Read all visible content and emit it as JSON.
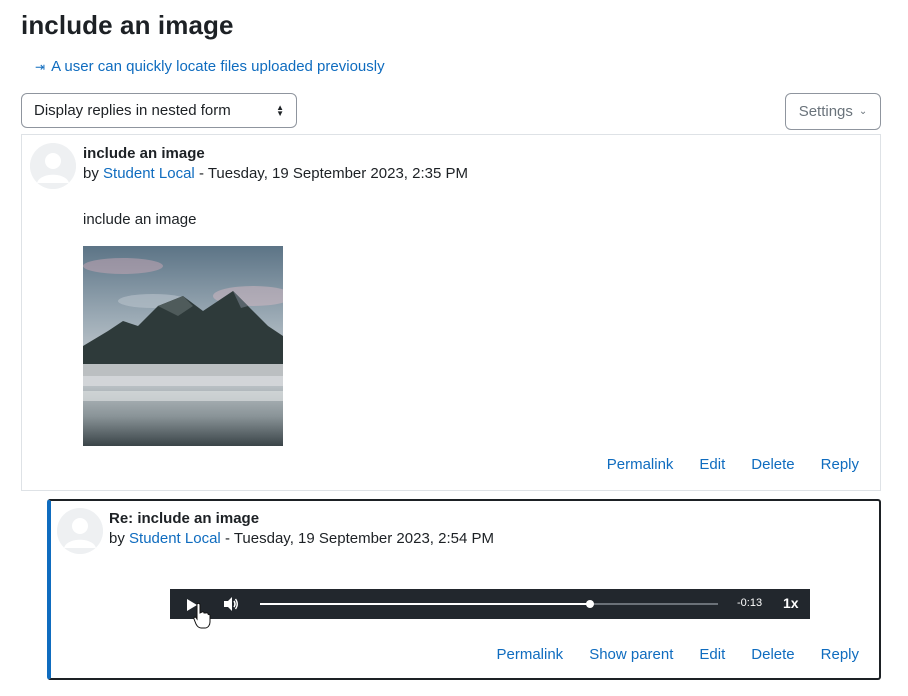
{
  "page": {
    "title": "include an image",
    "nav_link": "A user can quickly locate files uploaded previously",
    "display_mode": "Display replies in nested form",
    "settings_label": "Settings"
  },
  "posts": [
    {
      "subject": "include an image",
      "by_prefix": "by",
      "author": "Student Local",
      "date": "- Tuesday, 19 September 2023, 2:35 PM",
      "body_text": "include an image",
      "image": "mountain-landscape-image",
      "actions": [
        "Permalink",
        "Edit",
        "Delete",
        "Reply"
      ]
    },
    {
      "subject": "Re: include an image",
      "by_prefix": "by",
      "author": "Student Local",
      "date": "- Tuesday, 19 September 2023, 2:54 PM",
      "media": {
        "time_remaining": "-0:13",
        "speed": "1x",
        "progress_fraction": 0.72
      },
      "actions": [
        "Permalink",
        "Show parent",
        "Edit",
        "Delete",
        "Reply"
      ]
    }
  ],
  "colors": {
    "link": "#0f6cbf",
    "text": "#1d2125",
    "player_bg": "#22272d",
    "border": "#dee2e6"
  }
}
